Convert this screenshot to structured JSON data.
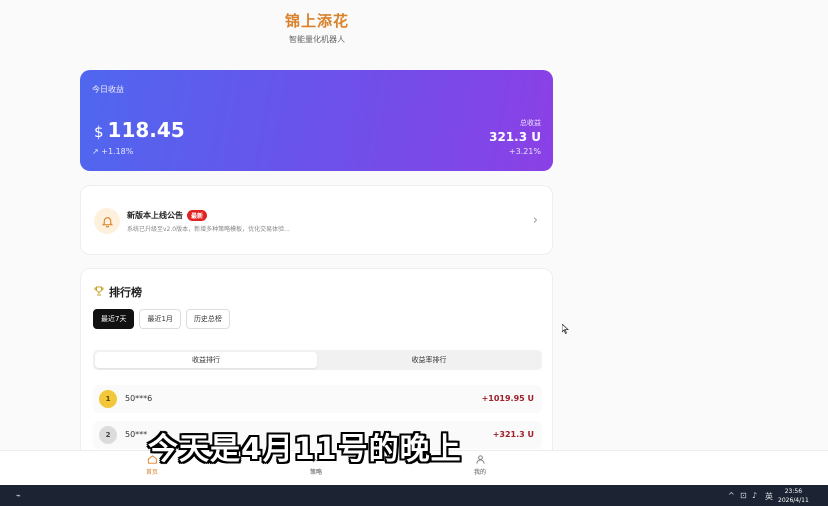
{
  "brand": {
    "title": "锦上添花",
    "subtitle": "智能量化机器人"
  },
  "earnings": {
    "label": "今日收益",
    "currency_symbol": "$",
    "amount": "118.45",
    "change": "+1.18%",
    "total_label": "总收益",
    "total_value": "321.3 U",
    "total_change": "+3.21%"
  },
  "notice": {
    "title": "新版本上线公告",
    "badge": "最新",
    "description": "系统已升级至v2.0版本，新增多种策略模板，优化交易体验..."
  },
  "ranking": {
    "title": "排行榜",
    "period_tabs": [
      "最近7天",
      "最近1月",
      "历史总榜"
    ],
    "active_period": "最近7天",
    "segments": [
      "收益排行",
      "收益率排行"
    ],
    "rows": [
      {
        "rank": "1",
        "user": "50***6",
        "value": "+1019.95 U"
      },
      {
        "rank": "2",
        "user": "50***",
        "value": "+321.3 U"
      }
    ]
  },
  "caption": "今天是4月11号的晚上",
  "bottom_nav": [
    {
      "label": "首页",
      "icon": "home-icon"
    },
    {
      "label": "策略",
      "icon": "strategy-icon"
    },
    {
      "label": "我的",
      "icon": "user-icon"
    }
  ],
  "taskbar": {
    "ime": "英",
    "time": "23:56",
    "date": "2026/4/11"
  },
  "colors": {
    "brand": "#d9822b",
    "card_gradient_start": "#4f67ee",
    "card_gradient_end": "#8b40e6",
    "positive": "#a0202a"
  }
}
